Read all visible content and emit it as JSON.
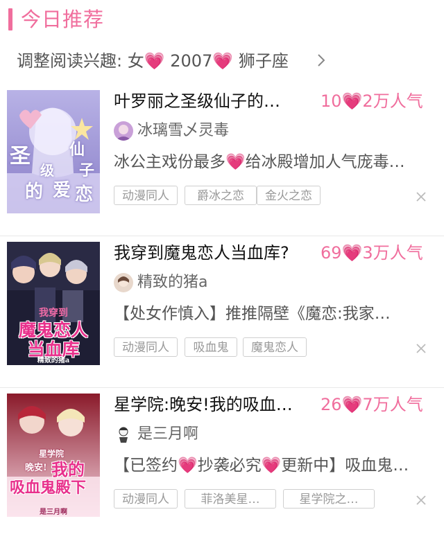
{
  "header": {
    "title": "今日推荐"
  },
  "interest": {
    "label": "调整阅读兴趣:",
    "gender": "女",
    "year": "2007",
    "zodiac": "狮子座"
  },
  "books": [
    {
      "cover_text": [
        "圣",
        "仙",
        "级",
        "子",
        "的",
        "爱",
        "恋"
      ],
      "title": "叶罗丽之圣级仙子的…",
      "popularity": "10💗2万人气",
      "author": "冰璃雪乄灵毒",
      "description": "冰公主戏份最多💗给冰殿增加人气庞毒…",
      "tags": [
        "动漫同人",
        "爵冰之恋",
        "金火之恋"
      ]
    },
    {
      "cover_text": [
        "我穿到",
        "魔鬼恋人",
        "当血库",
        "精致的猪a"
      ],
      "title": "我穿到魔鬼恋人当血库?",
      "popularity": "69💗3万人气",
      "author": "精致的猪a",
      "description": "【处女作慎入】推推隔壁《魔恋:我家…",
      "tags": [
        "动漫同人",
        "吸血鬼",
        "魔鬼恋人"
      ]
    },
    {
      "cover_text": [
        "星学院",
        "晚安!",
        "我的",
        "吸血鬼殿下",
        "是三月啊"
      ],
      "title": "星学院:晚安!我的吸血…",
      "popularity": "26💗7万人气",
      "author": "是三月啊",
      "description": "【已签约💗抄袭必究💗更新中】吸血鬼…",
      "tags": [
        "动漫同人",
        "菲洛美星…",
        "星学院之…"
      ]
    }
  ],
  "colors": {
    "accent": "#f06e9d",
    "text": "#333333",
    "muted": "#999999"
  },
  "icons": {
    "header": "pink-bar-icon",
    "chevron": "chevron-right-icon",
    "close": "close-icon",
    "heart": "pink-heart-icon"
  }
}
